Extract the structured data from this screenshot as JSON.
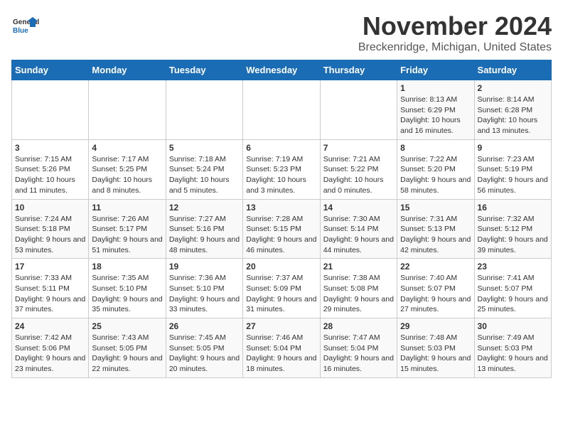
{
  "header": {
    "logo_general": "General",
    "logo_blue": "Blue",
    "month": "November 2024",
    "location": "Breckenridge, Michigan, United States"
  },
  "weekdays": [
    "Sunday",
    "Monday",
    "Tuesday",
    "Wednesday",
    "Thursday",
    "Friday",
    "Saturday"
  ],
  "weeks": [
    [
      {
        "day": "",
        "sunrise": "",
        "sunset": "",
        "daylight": ""
      },
      {
        "day": "",
        "sunrise": "",
        "sunset": "",
        "daylight": ""
      },
      {
        "day": "",
        "sunrise": "",
        "sunset": "",
        "daylight": ""
      },
      {
        "day": "",
        "sunrise": "",
        "sunset": "",
        "daylight": ""
      },
      {
        "day": "",
        "sunrise": "",
        "sunset": "",
        "daylight": ""
      },
      {
        "day": "1",
        "sunrise": "Sunrise: 8:13 AM",
        "sunset": "Sunset: 6:29 PM",
        "daylight": "Daylight: 10 hours and 16 minutes."
      },
      {
        "day": "2",
        "sunrise": "Sunrise: 8:14 AM",
        "sunset": "Sunset: 6:28 PM",
        "daylight": "Daylight: 10 hours and 13 minutes."
      }
    ],
    [
      {
        "day": "3",
        "sunrise": "Sunrise: 7:15 AM",
        "sunset": "Sunset: 5:26 PM",
        "daylight": "Daylight: 10 hours and 11 minutes."
      },
      {
        "day": "4",
        "sunrise": "Sunrise: 7:17 AM",
        "sunset": "Sunset: 5:25 PM",
        "daylight": "Daylight: 10 hours and 8 minutes."
      },
      {
        "day": "5",
        "sunrise": "Sunrise: 7:18 AM",
        "sunset": "Sunset: 5:24 PM",
        "daylight": "Daylight: 10 hours and 5 minutes."
      },
      {
        "day": "6",
        "sunrise": "Sunrise: 7:19 AM",
        "sunset": "Sunset: 5:23 PM",
        "daylight": "Daylight: 10 hours and 3 minutes."
      },
      {
        "day": "7",
        "sunrise": "Sunrise: 7:21 AM",
        "sunset": "Sunset: 5:22 PM",
        "daylight": "Daylight: 10 hours and 0 minutes."
      },
      {
        "day": "8",
        "sunrise": "Sunrise: 7:22 AM",
        "sunset": "Sunset: 5:20 PM",
        "daylight": "Daylight: 9 hours and 58 minutes."
      },
      {
        "day": "9",
        "sunrise": "Sunrise: 7:23 AM",
        "sunset": "Sunset: 5:19 PM",
        "daylight": "Daylight: 9 hours and 56 minutes."
      }
    ],
    [
      {
        "day": "10",
        "sunrise": "Sunrise: 7:24 AM",
        "sunset": "Sunset: 5:18 PM",
        "daylight": "Daylight: 9 hours and 53 minutes."
      },
      {
        "day": "11",
        "sunrise": "Sunrise: 7:26 AM",
        "sunset": "Sunset: 5:17 PM",
        "daylight": "Daylight: 9 hours and 51 minutes."
      },
      {
        "day": "12",
        "sunrise": "Sunrise: 7:27 AM",
        "sunset": "Sunset: 5:16 PM",
        "daylight": "Daylight: 9 hours and 48 minutes."
      },
      {
        "day": "13",
        "sunrise": "Sunrise: 7:28 AM",
        "sunset": "Sunset: 5:15 PM",
        "daylight": "Daylight: 9 hours and 46 minutes."
      },
      {
        "day": "14",
        "sunrise": "Sunrise: 7:30 AM",
        "sunset": "Sunset: 5:14 PM",
        "daylight": "Daylight: 9 hours and 44 minutes."
      },
      {
        "day": "15",
        "sunrise": "Sunrise: 7:31 AM",
        "sunset": "Sunset: 5:13 PM",
        "daylight": "Daylight: 9 hours and 42 minutes."
      },
      {
        "day": "16",
        "sunrise": "Sunrise: 7:32 AM",
        "sunset": "Sunset: 5:12 PM",
        "daylight": "Daylight: 9 hours and 39 minutes."
      }
    ],
    [
      {
        "day": "17",
        "sunrise": "Sunrise: 7:33 AM",
        "sunset": "Sunset: 5:11 PM",
        "daylight": "Daylight: 9 hours and 37 minutes."
      },
      {
        "day": "18",
        "sunrise": "Sunrise: 7:35 AM",
        "sunset": "Sunset: 5:10 PM",
        "daylight": "Daylight: 9 hours and 35 minutes."
      },
      {
        "day": "19",
        "sunrise": "Sunrise: 7:36 AM",
        "sunset": "Sunset: 5:10 PM",
        "daylight": "Daylight: 9 hours and 33 minutes."
      },
      {
        "day": "20",
        "sunrise": "Sunrise: 7:37 AM",
        "sunset": "Sunset: 5:09 PM",
        "daylight": "Daylight: 9 hours and 31 minutes."
      },
      {
        "day": "21",
        "sunrise": "Sunrise: 7:38 AM",
        "sunset": "Sunset: 5:08 PM",
        "daylight": "Daylight: 9 hours and 29 minutes."
      },
      {
        "day": "22",
        "sunrise": "Sunrise: 7:40 AM",
        "sunset": "Sunset: 5:07 PM",
        "daylight": "Daylight: 9 hours and 27 minutes."
      },
      {
        "day": "23",
        "sunrise": "Sunrise: 7:41 AM",
        "sunset": "Sunset: 5:07 PM",
        "daylight": "Daylight: 9 hours and 25 minutes."
      }
    ],
    [
      {
        "day": "24",
        "sunrise": "Sunrise: 7:42 AM",
        "sunset": "Sunset: 5:06 PM",
        "daylight": "Daylight: 9 hours and 23 minutes."
      },
      {
        "day": "25",
        "sunrise": "Sunrise: 7:43 AM",
        "sunset": "Sunset: 5:05 PM",
        "daylight": "Daylight: 9 hours and 22 minutes."
      },
      {
        "day": "26",
        "sunrise": "Sunrise: 7:45 AM",
        "sunset": "Sunset: 5:05 PM",
        "daylight": "Daylight: 9 hours and 20 minutes."
      },
      {
        "day": "27",
        "sunrise": "Sunrise: 7:46 AM",
        "sunset": "Sunset: 5:04 PM",
        "daylight": "Daylight: 9 hours and 18 minutes."
      },
      {
        "day": "28",
        "sunrise": "Sunrise: 7:47 AM",
        "sunset": "Sunset: 5:04 PM",
        "daylight": "Daylight: 9 hours and 16 minutes."
      },
      {
        "day": "29",
        "sunrise": "Sunrise: 7:48 AM",
        "sunset": "Sunset: 5:03 PM",
        "daylight": "Daylight: 9 hours and 15 minutes."
      },
      {
        "day": "30",
        "sunrise": "Sunrise: 7:49 AM",
        "sunset": "Sunset: 5:03 PM",
        "daylight": "Daylight: 9 hours and 13 minutes."
      }
    ]
  ]
}
